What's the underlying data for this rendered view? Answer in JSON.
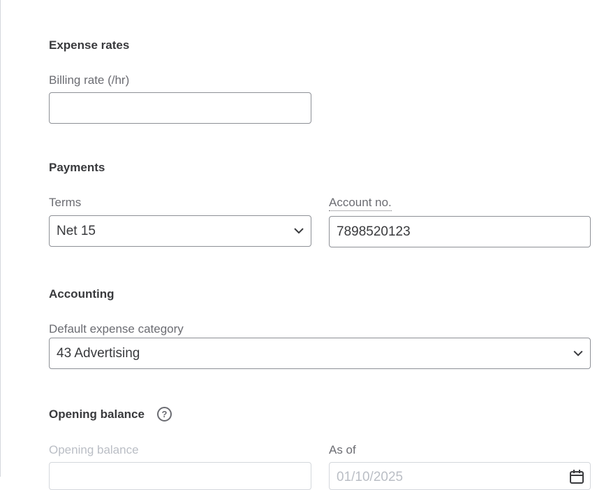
{
  "expense_rates": {
    "title": "Expense rates",
    "billing_rate_label": "Billing rate (/hr)",
    "billing_rate_value": ""
  },
  "payments": {
    "title": "Payments",
    "terms_label": "Terms",
    "terms_value": "Net 15",
    "account_label": "Account no.",
    "account_value": "7898520123"
  },
  "accounting": {
    "title": "Accounting",
    "category_label": "Default expense category",
    "category_value": "43 Advertising"
  },
  "opening_balance": {
    "title": "Opening balance",
    "help_icon": "question-circle-icon",
    "balance_label": "Opening balance",
    "balance_value": "",
    "as_of_label": "As of",
    "as_of_value": "01/10/2025",
    "calendar_icon": "calendar-icon"
  }
}
